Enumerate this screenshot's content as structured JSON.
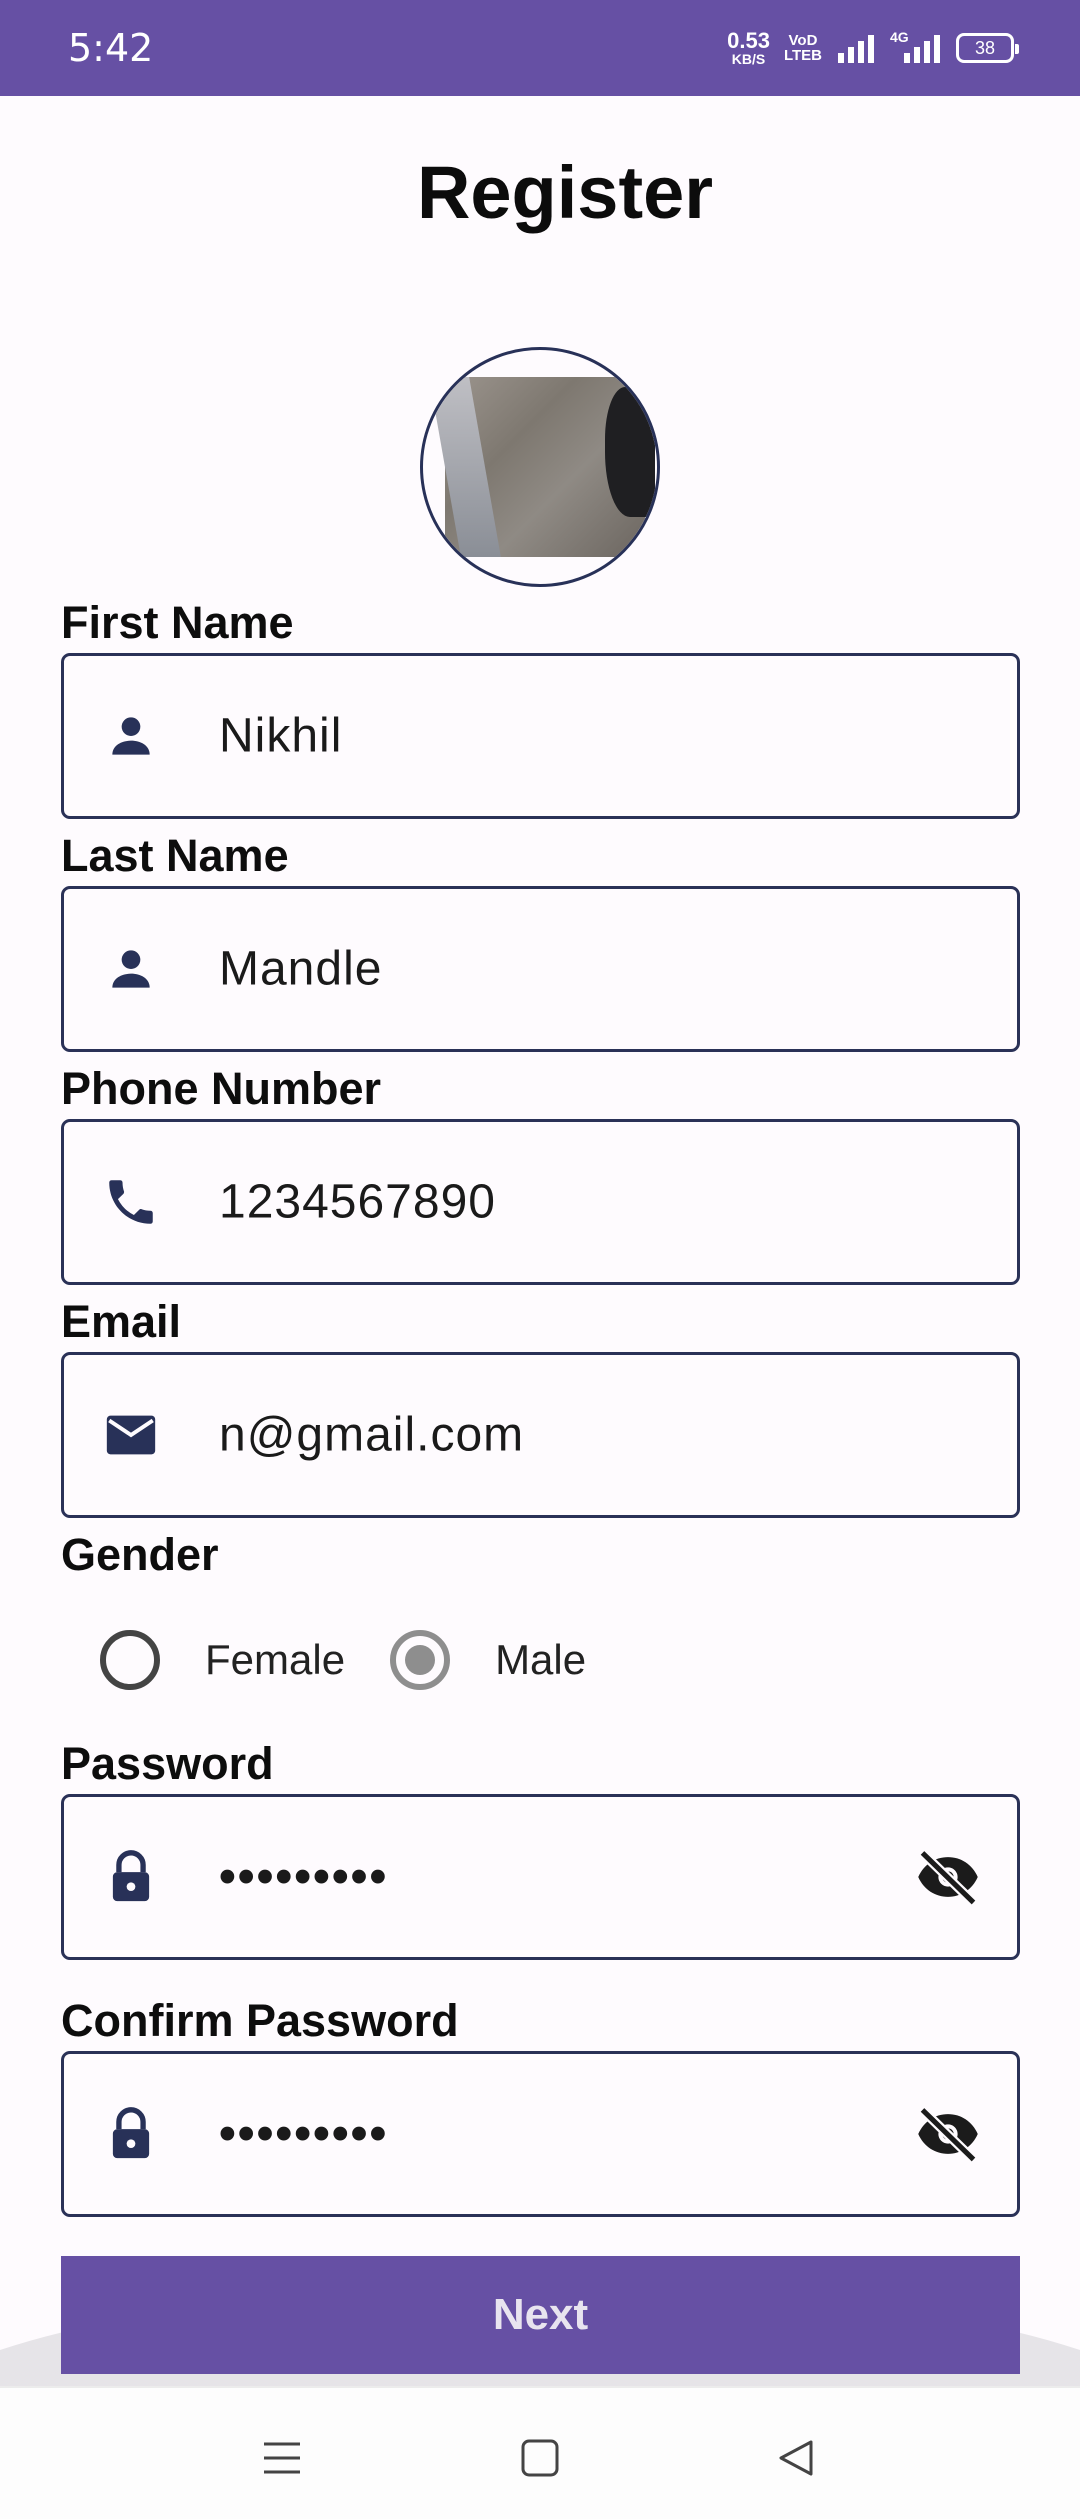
{
  "status_bar": {
    "time": "5:42",
    "net_speed_value": "0.53",
    "net_speed_unit": "KB/S",
    "volte_top": "VoD",
    "volte_bottom": "LTEB",
    "network_type": "4G",
    "battery": "38"
  },
  "page": {
    "title": "Register"
  },
  "form": {
    "first_name": {
      "label": "First Name",
      "value": "Nikhil",
      "icon": "person-icon"
    },
    "last_name": {
      "label": "Last Name",
      "value": "Mandle",
      "icon": "person-icon"
    },
    "phone": {
      "label": "Phone Number",
      "value": "1234567890",
      "icon": "phone-icon"
    },
    "email": {
      "label": "Email",
      "value": "n@gmail.com",
      "icon": "mail-icon"
    },
    "gender": {
      "label": "Gender",
      "options": [
        "Female",
        "Male"
      ],
      "selected": "Male"
    },
    "password": {
      "label": "Password",
      "value": "•••••••••",
      "icon": "lock-icon"
    },
    "confirm_password": {
      "label": "Confirm Password",
      "value": "•••••••••",
      "icon": "lock-icon"
    }
  },
  "actions": {
    "next_label": "Next"
  },
  "colors": {
    "primary": "#6650a4",
    "icon": "#283158",
    "border": "#2a3157"
  }
}
